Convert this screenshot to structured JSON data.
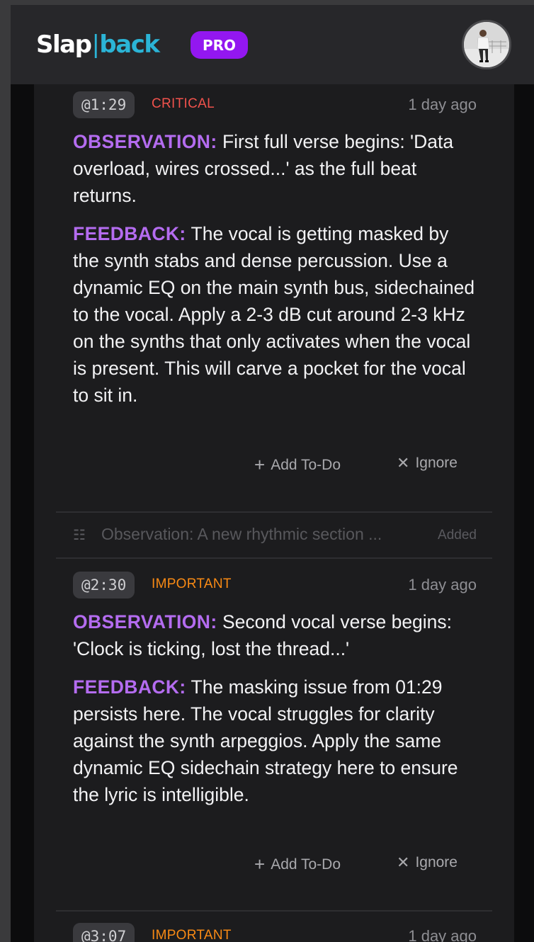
{
  "header": {
    "logo_part1": "Slap",
    "logo_separator": "|",
    "logo_part2": "back",
    "plan_badge": "PRO"
  },
  "colors": {
    "critical": "#f0524c",
    "important": "#f98a14",
    "label": "#b46cf0",
    "brand_accent": "#2bb4d6",
    "pro_badge": "#9317f0"
  },
  "feedback_items": [
    {
      "timestamp": "@1:29",
      "severity": "CRITICAL",
      "age": "1 day ago",
      "observation_label": "OBSERVATION:",
      "observation": "First full verse begins: 'Data overload, wires crossed...' as the full beat returns.",
      "feedback_label": "FEEDBACK:",
      "feedback": "The vocal is getting masked by the synth stabs and dense percussion. Use a dynamic EQ on the main synth bus, sidechained to the vocal. Apply a 2-3 dB cut around 2-3 kHz on the synths that only activates when the vocal is present. This will carve a pocket for the vocal to sit in.",
      "add_todo_label": "Add To-Do",
      "ignore_label": "Ignore"
    },
    {
      "timestamp": "@2:30",
      "severity": "IMPORTANT",
      "age": "1 day ago",
      "observation_label": "OBSERVATION:",
      "observation": "Second vocal verse begins: 'Clock is ticking, lost the thread...'",
      "feedback_label": "FEEDBACK:",
      "feedback": "The masking issue from 01:29 persists here. The vocal struggles for clarity against the synth arpeggios. Apply the same dynamic EQ sidechain strategy here to ensure the lyric is intelligible.",
      "add_todo_label": "Add To-Do",
      "ignore_label": "Ignore"
    },
    {
      "timestamp": "@3:07",
      "severity": "IMPORTANT",
      "age": "1 day ago"
    }
  ],
  "collapsed_item": {
    "text": "Observation: A new rhythmic section ...",
    "status": "Added"
  },
  "icons": {
    "add": "plus-icon",
    "ignore": "x-icon",
    "todo": "checklist-icon"
  }
}
